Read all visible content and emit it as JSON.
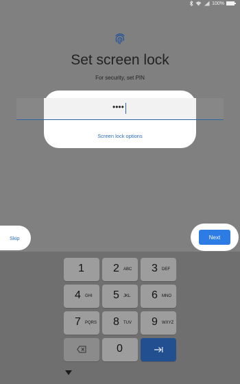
{
  "status_bar": {
    "battery_percent": "100%",
    "battery_level": 1.0,
    "icons": [
      "bluetooth-icon",
      "wifi-icon",
      "signal-icon",
      "battery-icon"
    ]
  },
  "header": {
    "icon": "fingerprint-icon",
    "title": "Set screen lock",
    "subtitle": "For security, set PIN"
  },
  "pin_field": {
    "value_masked": "••••",
    "lock_options_label": "Screen lock options"
  },
  "actions": {
    "skip_label": "Skip",
    "next_label": "Next"
  },
  "keypad": {
    "keys": [
      {
        "num": "1",
        "letters": ""
      },
      {
        "num": "2",
        "letters": "ABC"
      },
      {
        "num": "3",
        "letters": "DEF"
      },
      {
        "num": "4",
        "letters": "GHI"
      },
      {
        "num": "5",
        "letters": "JKL"
      },
      {
        "num": "6",
        "letters": "MNO"
      },
      {
        "num": "7",
        "letters": "PQRS"
      },
      {
        "num": "8",
        "letters": "TUV"
      },
      {
        "num": "9",
        "letters": "WXYZ"
      },
      {
        "num": "",
        "letters": "",
        "icon": "backspace-icon"
      },
      {
        "num": "0",
        "letters": ""
      },
      {
        "num": "",
        "letters": "",
        "icon": "enter-icon"
      }
    ]
  },
  "colors": {
    "accent": "#2d7be5",
    "link": "#2a6bbd",
    "scrim": "#808080",
    "enter_key": "#214f8f"
  }
}
